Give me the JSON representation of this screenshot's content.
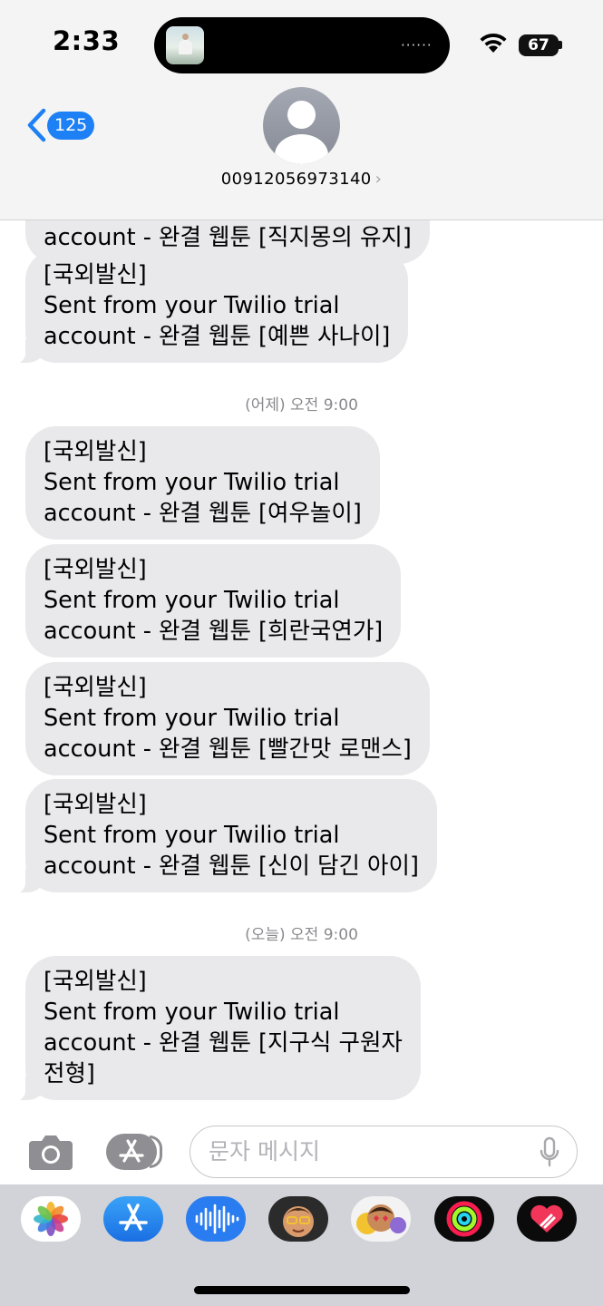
{
  "status_bar": {
    "time": "2:33",
    "island_indicator": "······",
    "battery": "67"
  },
  "header": {
    "back_count": "125",
    "contact": "00912056973140",
    "contact_chevron": "›"
  },
  "messages": {
    "partial": {
      "line": "account - 완결 웹툰 [직지몽의 유지]"
    },
    "group1": [
      {
        "lines": [
          "[국외발신]",
          "Sent from your Twilio trial",
          "account - 완결 웹툰 [예쁜 사나이]"
        ]
      }
    ],
    "timestamp1": "(어제) 오전 9:00",
    "group2": [
      {
        "lines": [
          "[국외발신]",
          "Sent from your Twilio trial",
          "account - 완결 웹툰 [여우놀이]"
        ]
      },
      {
        "lines": [
          "[국외발신]",
          "Sent from your Twilio trial",
          "account - 완결 웹툰 [희란국연가]"
        ]
      },
      {
        "lines": [
          "[국외발신]",
          "Sent from your Twilio trial",
          "account - 완결 웹툰 [빨간맛 로맨스]"
        ]
      },
      {
        "lines": [
          "[국외발신]",
          "Sent from your Twilio trial",
          "account - 완결 웹툰 [신이 담긴 아이]"
        ]
      }
    ],
    "timestamp2": "(오늘) 오전 9:00",
    "group3": [
      {
        "lines": [
          "[국외발신]",
          "Sent from your Twilio trial",
          "account - 완결 웹툰 [지구식 구원자",
          "전형]"
        ]
      }
    ]
  },
  "composer": {
    "placeholder": "문자 메시지"
  },
  "colors": {
    "accent": "#1e80f5",
    "bubble": "#e9e9eb",
    "tray": "#d1d3d9"
  },
  "icons": {
    "back": "chevron-left-icon",
    "camera": "camera-icon",
    "appstore": "app-store-icon",
    "mic": "microphone-icon",
    "tray": [
      "photos-icon",
      "app-store-icon",
      "audio-message-icon",
      "memoji-icon",
      "animoji-stickers-icon",
      "activity-icon",
      "digital-touch-icon"
    ]
  }
}
